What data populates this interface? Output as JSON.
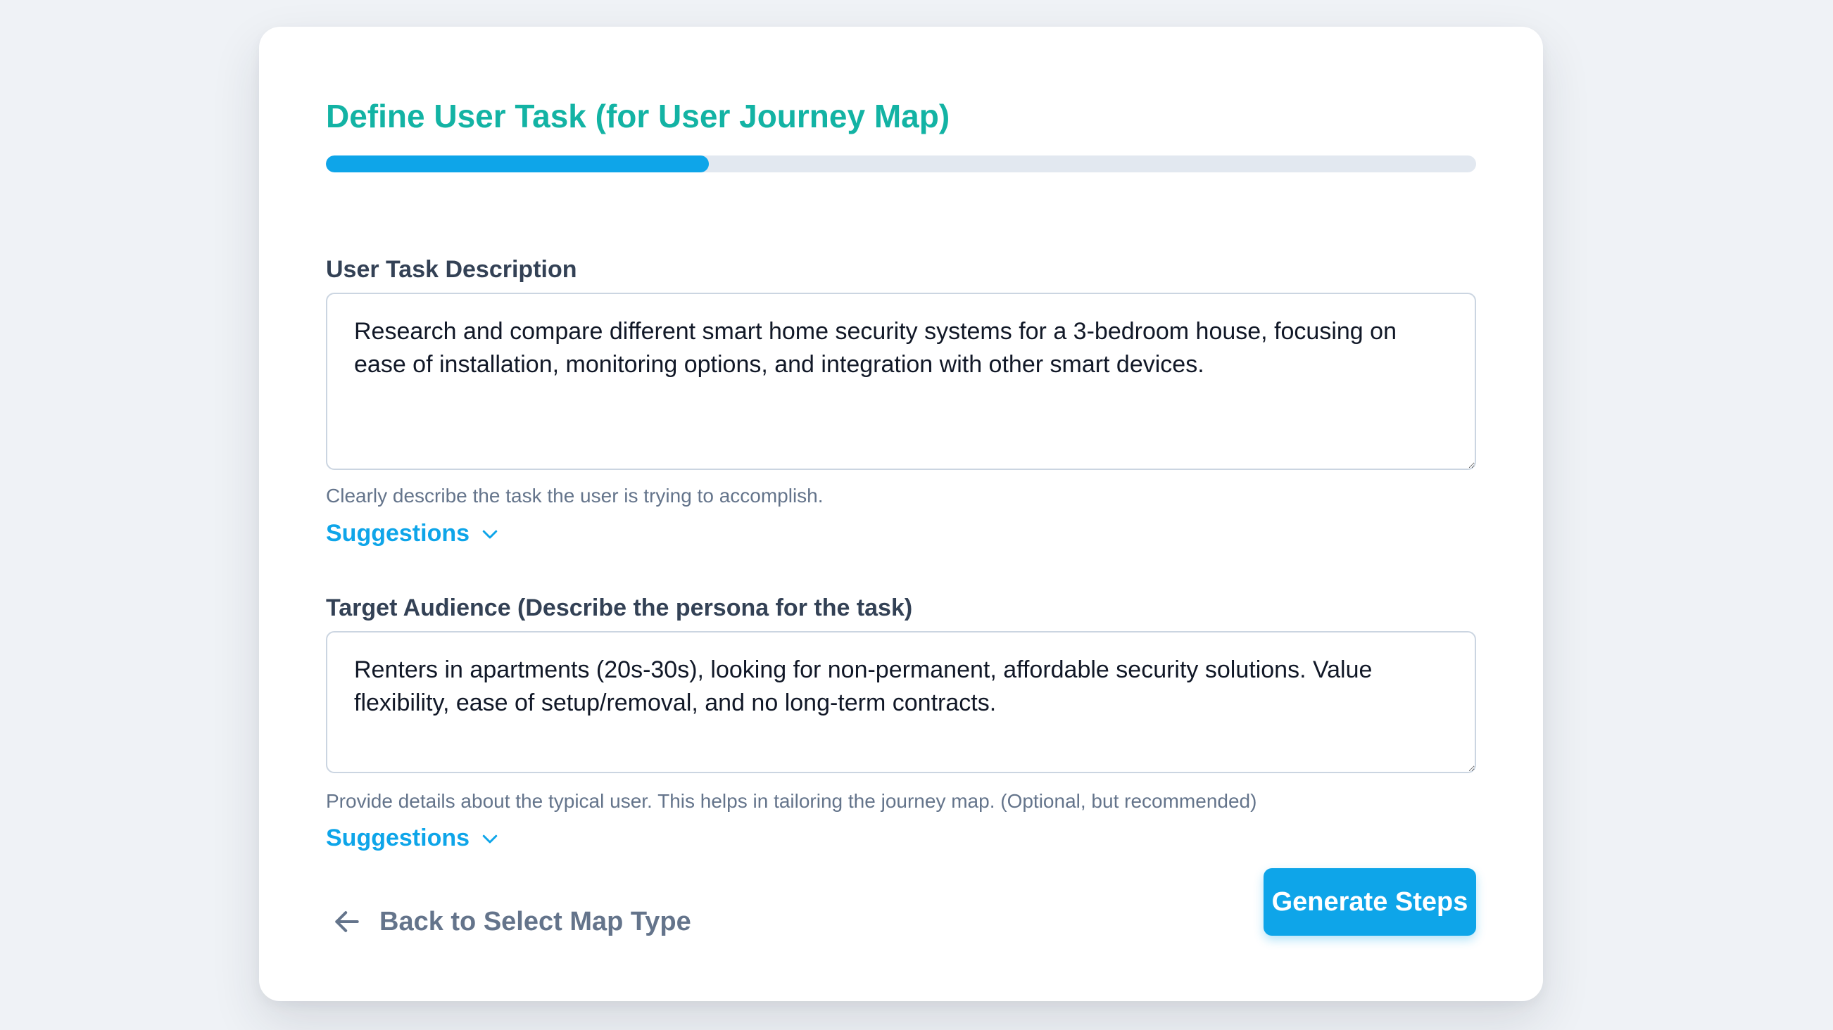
{
  "page": {
    "title": "Define User Task (for User Journey Map)",
    "progress_percent": 33.3
  },
  "task_field": {
    "label": "User Task Description",
    "value": "Research and compare different smart home security systems for a 3-bedroom house, focusing on ease of installation, monitoring options, and integration with other smart devices.",
    "help": "Clearly describe the task the user is trying to accomplish.",
    "suggestions_label": "Suggestions"
  },
  "audience_field": {
    "label": "Target Audience (Describe the persona for the task)",
    "value": "Renters in apartments (20s-30s), looking for non-permanent, affordable security solutions. Value flexibility, ease of setup/removal, and no long-term contracts.",
    "help": "Provide details about the typical user. This helps in tailoring the journey map. (Optional, but recommended)",
    "suggestions_label": "Suggestions"
  },
  "footer": {
    "back_label": "Back to Select Map Type",
    "generate_label": "Generate Steps"
  },
  "colors": {
    "title": "#13b3a4",
    "accent": "#0ea5e9",
    "background": "#eff2f6"
  },
  "icons": {
    "suggestions_toggle": "chevron-down-icon",
    "back": "arrow-left-icon"
  }
}
